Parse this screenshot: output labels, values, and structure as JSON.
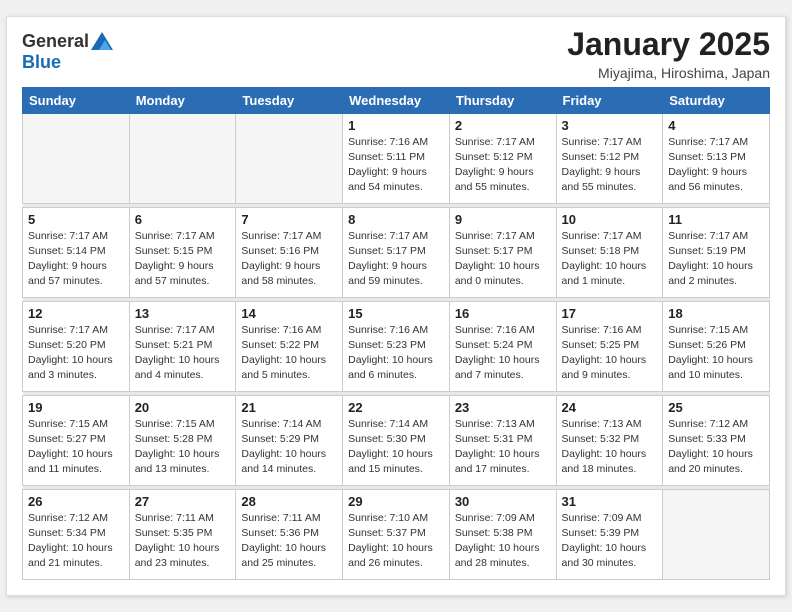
{
  "header": {
    "logo_general": "General",
    "logo_blue": "Blue",
    "month_title": "January 2025",
    "location": "Miyajima, Hiroshima, Japan"
  },
  "days_of_week": [
    "Sunday",
    "Monday",
    "Tuesday",
    "Wednesday",
    "Thursday",
    "Friday",
    "Saturday"
  ],
  "weeks": [
    [
      {
        "date": "",
        "info": ""
      },
      {
        "date": "",
        "info": ""
      },
      {
        "date": "",
        "info": ""
      },
      {
        "date": "1",
        "info": "Sunrise: 7:16 AM\nSunset: 5:11 PM\nDaylight: 9 hours\nand 54 minutes."
      },
      {
        "date": "2",
        "info": "Sunrise: 7:17 AM\nSunset: 5:12 PM\nDaylight: 9 hours\nand 55 minutes."
      },
      {
        "date": "3",
        "info": "Sunrise: 7:17 AM\nSunset: 5:12 PM\nDaylight: 9 hours\nand 55 minutes."
      },
      {
        "date": "4",
        "info": "Sunrise: 7:17 AM\nSunset: 5:13 PM\nDaylight: 9 hours\nand 56 minutes."
      }
    ],
    [
      {
        "date": "5",
        "info": "Sunrise: 7:17 AM\nSunset: 5:14 PM\nDaylight: 9 hours\nand 57 minutes."
      },
      {
        "date": "6",
        "info": "Sunrise: 7:17 AM\nSunset: 5:15 PM\nDaylight: 9 hours\nand 57 minutes."
      },
      {
        "date": "7",
        "info": "Sunrise: 7:17 AM\nSunset: 5:16 PM\nDaylight: 9 hours\nand 58 minutes."
      },
      {
        "date": "8",
        "info": "Sunrise: 7:17 AM\nSunset: 5:17 PM\nDaylight: 9 hours\nand 59 minutes."
      },
      {
        "date": "9",
        "info": "Sunrise: 7:17 AM\nSunset: 5:17 PM\nDaylight: 10 hours\nand 0 minutes."
      },
      {
        "date": "10",
        "info": "Sunrise: 7:17 AM\nSunset: 5:18 PM\nDaylight: 10 hours\nand 1 minute."
      },
      {
        "date": "11",
        "info": "Sunrise: 7:17 AM\nSunset: 5:19 PM\nDaylight: 10 hours\nand 2 minutes."
      }
    ],
    [
      {
        "date": "12",
        "info": "Sunrise: 7:17 AM\nSunset: 5:20 PM\nDaylight: 10 hours\nand 3 minutes."
      },
      {
        "date": "13",
        "info": "Sunrise: 7:17 AM\nSunset: 5:21 PM\nDaylight: 10 hours\nand 4 minutes."
      },
      {
        "date": "14",
        "info": "Sunrise: 7:16 AM\nSunset: 5:22 PM\nDaylight: 10 hours\nand 5 minutes."
      },
      {
        "date": "15",
        "info": "Sunrise: 7:16 AM\nSunset: 5:23 PM\nDaylight: 10 hours\nand 6 minutes."
      },
      {
        "date": "16",
        "info": "Sunrise: 7:16 AM\nSunset: 5:24 PM\nDaylight: 10 hours\nand 7 minutes."
      },
      {
        "date": "17",
        "info": "Sunrise: 7:16 AM\nSunset: 5:25 PM\nDaylight: 10 hours\nand 9 minutes."
      },
      {
        "date": "18",
        "info": "Sunrise: 7:15 AM\nSunset: 5:26 PM\nDaylight: 10 hours\nand 10 minutes."
      }
    ],
    [
      {
        "date": "19",
        "info": "Sunrise: 7:15 AM\nSunset: 5:27 PM\nDaylight: 10 hours\nand 11 minutes."
      },
      {
        "date": "20",
        "info": "Sunrise: 7:15 AM\nSunset: 5:28 PM\nDaylight: 10 hours\nand 13 minutes."
      },
      {
        "date": "21",
        "info": "Sunrise: 7:14 AM\nSunset: 5:29 PM\nDaylight: 10 hours\nand 14 minutes."
      },
      {
        "date": "22",
        "info": "Sunrise: 7:14 AM\nSunset: 5:30 PM\nDaylight: 10 hours\nand 15 minutes."
      },
      {
        "date": "23",
        "info": "Sunrise: 7:13 AM\nSunset: 5:31 PM\nDaylight: 10 hours\nand 17 minutes."
      },
      {
        "date": "24",
        "info": "Sunrise: 7:13 AM\nSunset: 5:32 PM\nDaylight: 10 hours\nand 18 minutes."
      },
      {
        "date": "25",
        "info": "Sunrise: 7:12 AM\nSunset: 5:33 PM\nDaylight: 10 hours\nand 20 minutes."
      }
    ],
    [
      {
        "date": "26",
        "info": "Sunrise: 7:12 AM\nSunset: 5:34 PM\nDaylight: 10 hours\nand 21 minutes."
      },
      {
        "date": "27",
        "info": "Sunrise: 7:11 AM\nSunset: 5:35 PM\nDaylight: 10 hours\nand 23 minutes."
      },
      {
        "date": "28",
        "info": "Sunrise: 7:11 AM\nSunset: 5:36 PM\nDaylight: 10 hours\nand 25 minutes."
      },
      {
        "date": "29",
        "info": "Sunrise: 7:10 AM\nSunset: 5:37 PM\nDaylight: 10 hours\nand 26 minutes."
      },
      {
        "date": "30",
        "info": "Sunrise: 7:09 AM\nSunset: 5:38 PM\nDaylight: 10 hours\nand 28 minutes."
      },
      {
        "date": "31",
        "info": "Sunrise: 7:09 AM\nSunset: 5:39 PM\nDaylight: 10 hours\nand 30 minutes."
      },
      {
        "date": "",
        "info": ""
      }
    ]
  ]
}
